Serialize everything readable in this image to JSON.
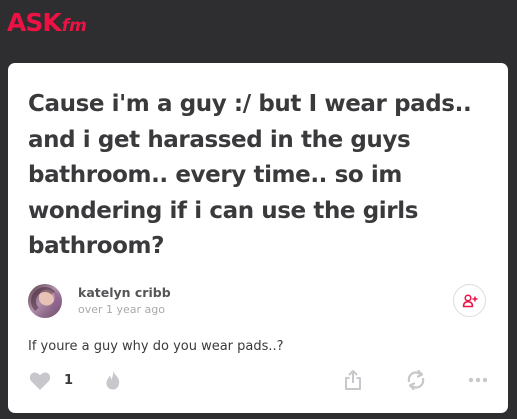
{
  "header": {
    "logo_ask": "ASK",
    "logo_fm": "fm"
  },
  "question": {
    "text": "Cause i'm a guy :/ but I wear pads.. and i get harassed in the guys bathroom.. every time.. so im wondering if i can use the girls bathroom?"
  },
  "answer": {
    "author_name": "katelyn cribb",
    "time": "over 1 year ago",
    "text": "If youre a guy why do you wear pads..?",
    "like_count": "1"
  },
  "icons": {
    "like": "heart-icon",
    "fire": "fire-icon",
    "share": "share-icon",
    "repost": "repost-icon",
    "more": "more-dots-icon",
    "follow": "add-user-icon"
  },
  "colors": {
    "background": "#2e2e31",
    "brand": "#ee1144",
    "card": "#ffffff",
    "text": "#3a3a3c",
    "muted": "#a9a9ad",
    "icon": "#c8c8cc"
  }
}
